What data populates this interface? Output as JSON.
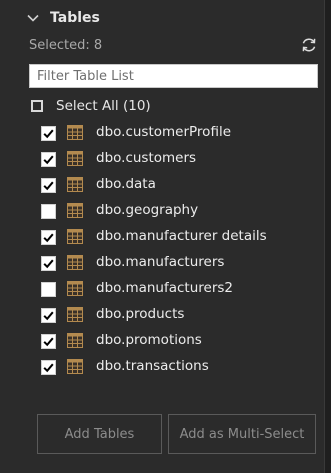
{
  "section": {
    "title": "Tables",
    "chevron_icon": "chevron-down-icon"
  },
  "status": {
    "selected_text": "Selected: 8"
  },
  "refresh": {
    "icon": "refresh-icon"
  },
  "filter": {
    "placeholder": "Filter Table List",
    "value": ""
  },
  "select_all": {
    "label": "Select All (10)",
    "checked": false
  },
  "tables": [
    {
      "name": "dbo.customerProfile",
      "checked": true
    },
    {
      "name": "dbo.customers",
      "checked": true
    },
    {
      "name": "dbo.data",
      "checked": true
    },
    {
      "name": "dbo.geography",
      "checked": false
    },
    {
      "name": "dbo.manufacturer details",
      "checked": true
    },
    {
      "name": "dbo.manufacturers",
      "checked": true
    },
    {
      "name": "dbo.manufacturers2",
      "checked": false
    },
    {
      "name": "dbo.products",
      "checked": true
    },
    {
      "name": "dbo.promotions",
      "checked": true
    },
    {
      "name": "dbo.transactions",
      "checked": true
    }
  ],
  "buttons": {
    "add_tables": "Add Tables",
    "add_multi_select": "Add as Multi-Select"
  },
  "colors": {
    "panel_bg": "#2b2b2b",
    "table_icon": "#b38a4f",
    "checkmark": "#000000"
  }
}
